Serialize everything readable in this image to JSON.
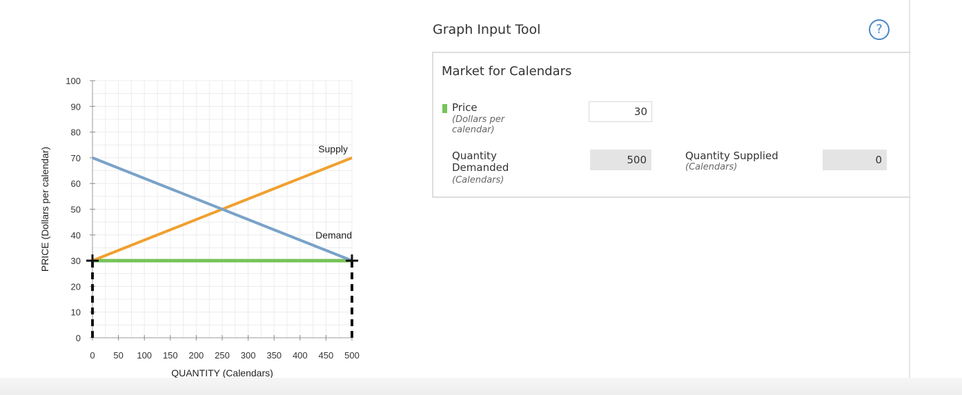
{
  "chart_data": {
    "type": "line",
    "xlabel": "QUANTITY (Calendars)",
    "ylabel": "PRICE (Dollars per calendar)",
    "xlim": [
      0,
      500
    ],
    "ylim": [
      0,
      100
    ],
    "xticks": [
      "0",
      "50",
      "100",
      "150",
      "200",
      "250",
      "300",
      "350",
      "400",
      "450",
      "500"
    ],
    "yticks": [
      "0",
      "10",
      "20",
      "30",
      "40",
      "50",
      "60",
      "70",
      "80",
      "90",
      "100"
    ],
    "grid": true,
    "series": [
      {
        "name": "Supply",
        "color": "#f0a030",
        "x": [
          0,
          500
        ],
        "y": [
          30,
          70
        ]
      },
      {
        "name": "Demand",
        "color": "#7aa2c8",
        "x": [
          0,
          500
        ],
        "y": [
          70,
          30
        ]
      }
    ],
    "price_line": {
      "color": "#76c35a",
      "x": [
        0,
        500
      ],
      "y": [
        30,
        30
      ]
    },
    "markers": [
      {
        "x": 0,
        "y": 30
      },
      {
        "x": 500,
        "y": 30
      }
    ]
  },
  "tool": {
    "title": "Graph Input Tool",
    "help_glyph": "?",
    "panel_title": "Market for Calendars",
    "price_label": "Price",
    "price_sub_1": "(Dollars per",
    "price_sub_2": "calendar)",
    "price_value": "30",
    "qd_label_1": "Quantity",
    "qd_label_2": "Demanded",
    "qd_sub": "(Calendars)",
    "qd_value": "500",
    "qs_label": "Quantity Supplied",
    "qs_sub": "(Calendars)",
    "qs_value": "0",
    "price_marker_color": "#76c35a"
  }
}
